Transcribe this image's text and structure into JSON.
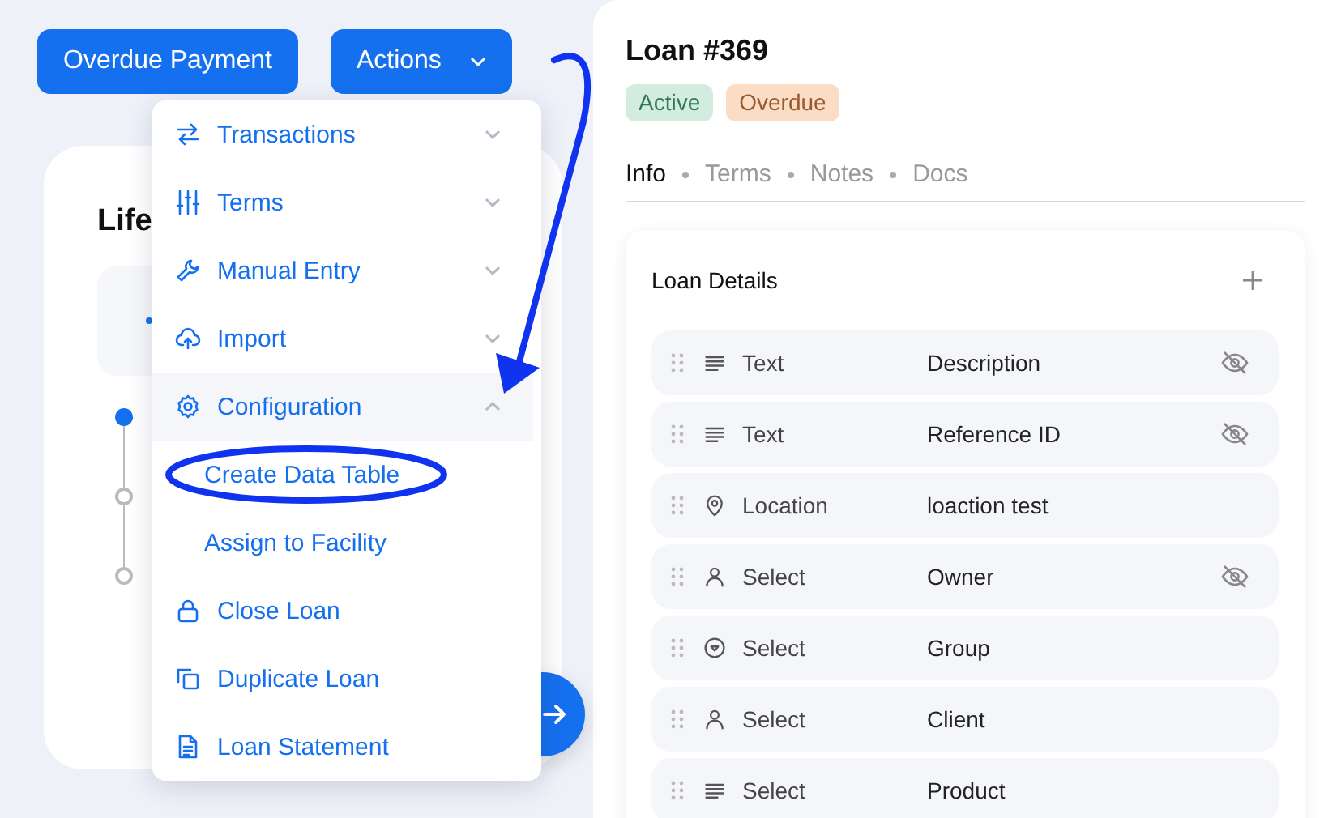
{
  "header_buttons": [
    {
      "label": "Overdue Payment",
      "kind": "plain"
    },
    {
      "label": "Actions",
      "kind": "dropdown"
    }
  ],
  "lifecycle_card": {
    "title": "Life",
    "steps": [
      {
        "selected": true
      },
      {
        "selected": false
      },
      {
        "selected": false
      }
    ]
  },
  "actions_menu": {
    "items": [
      {
        "label": "Transactions",
        "kind": "group",
        "expanded": false
      },
      {
        "label": "Terms",
        "kind": "group",
        "expanded": false
      },
      {
        "label": "Manual Entry",
        "kind": "group",
        "expanded": false
      },
      {
        "label": "Import",
        "kind": "group",
        "expanded": false
      },
      {
        "label": "Configuration",
        "kind": "group",
        "expanded": true,
        "children": [
          {
            "label": "Create Data Table"
          },
          {
            "label": "Assign to Facility"
          }
        ]
      },
      {
        "label": "Close Loan",
        "kind": "action"
      },
      {
        "label": "Duplicate Loan",
        "kind": "action"
      },
      {
        "label": "Loan Statement",
        "kind": "action"
      }
    ]
  },
  "loan": {
    "title": "Loan #369",
    "badges": [
      {
        "label": "Active",
        "kind": "success"
      },
      {
        "label": "Overdue",
        "kind": "warning"
      }
    ],
    "tabs": [
      {
        "label": "Info",
        "selected": true
      },
      {
        "label": "Terms",
        "selected": false
      },
      {
        "label": "Notes",
        "selected": false
      },
      {
        "label": "Docs",
        "selected": false
      }
    ],
    "details": {
      "title": "Loan Details",
      "rows": [
        {
          "type": "Text",
          "name": "Description",
          "kind": "text",
          "hidden": true
        },
        {
          "type": "Text",
          "name": "Reference ID",
          "kind": "text",
          "hidden": true
        },
        {
          "type": "Location",
          "name": "loaction test",
          "kind": "location",
          "hidden": false
        },
        {
          "type": "Select",
          "name": "Owner",
          "kind": "user",
          "hidden": true
        },
        {
          "type": "Select",
          "name": "Group",
          "kind": "group",
          "hidden": false
        },
        {
          "type": "Select",
          "name": "Client",
          "kind": "user",
          "hidden": false
        },
        {
          "type": "Select",
          "name": "Product",
          "kind": "text",
          "hidden": false
        }
      ]
    }
  }
}
